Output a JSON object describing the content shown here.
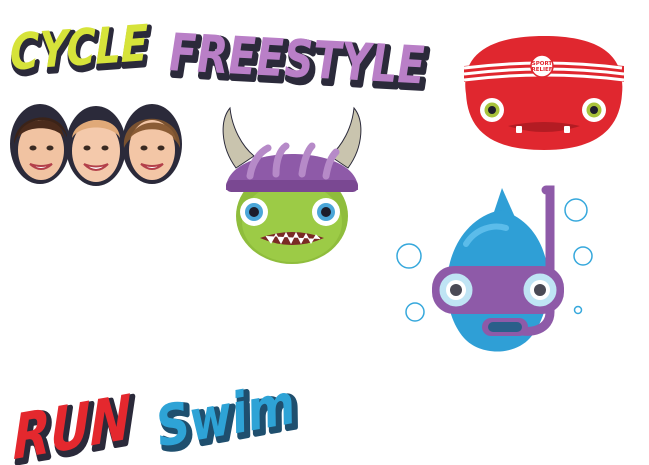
{
  "words": {
    "cycle": "CYCLE",
    "freestyle": "FREESTYLE",
    "run": "RUN",
    "swim": "Swim"
  },
  "badge": {
    "line1": "SPORT",
    "line2": "RELIEF"
  },
  "characters": [
    "cycle-monster",
    "blob-monster",
    "swim-fish",
    "presenter-faces"
  ],
  "colors": {
    "cycle": "#d6e33a",
    "freestyle": "#b97fc7",
    "run": "#e4282e",
    "swim": "#2ea3d6",
    "outline": "#2b2a3a",
    "green_monster": "#8fbd3c",
    "helmet": "#8e5aa8",
    "red_monster": "#e0272f",
    "fish": "#2f9fd6",
    "bubbles": "#36a8dc"
  }
}
